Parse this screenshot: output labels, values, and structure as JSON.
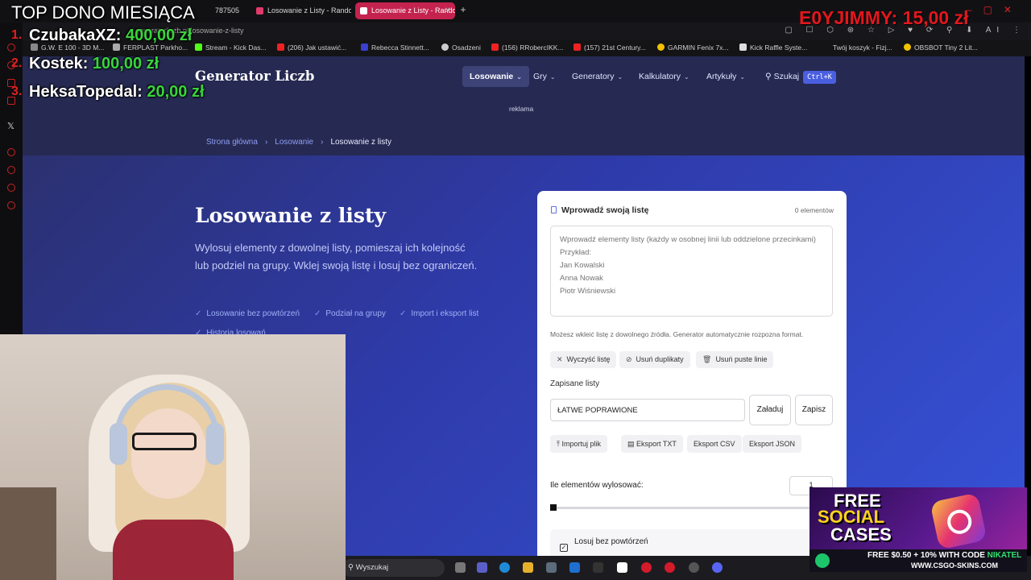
{
  "browser": {
    "tabs": [
      {
        "label": "787505"
      },
      {
        "label": "Losowanie z Listy - Rando"
      },
      {
        "label": "Losowanie z Listy - Rando",
        "active": true
      }
    ],
    "url": "generatorliczb.pl/losowanie-z-listy",
    "bookmarks": [
      "G.W. E 100 - 3D M...",
      "FERPLAST Parkho...",
      "Stream - Kick Das...",
      "(206) Jak ustawić...",
      "Rebecca Stinnett...",
      "Osadzeni",
      "(156) RRobercIKK...",
      "(157) 21st Century...",
      "GARMIN Fenix 7x...",
      "Kick Raffle Syste...",
      "Twój koszyk - Fizj...",
      "OBSBOT Tiny 2 Lit..."
    ],
    "toolbar_ai_label": "AI"
  },
  "site": {
    "logo": "Generator Liczb",
    "nav": [
      {
        "label": "Losowanie"
      },
      {
        "label": "Gry"
      },
      {
        "label": "Generatory"
      },
      {
        "label": "Kalkulatory"
      },
      {
        "label": "Artykuły"
      }
    ],
    "search_label": "Szukaj",
    "search_shortcut": "Ctrl+K",
    "ad_label": "reklama"
  },
  "breadcrumb": [
    "Strona główna",
    "Losowanie",
    "Losowanie z listy"
  ],
  "hero": {
    "title": "Losowanie z listy",
    "description": "Wylosuj elementy z dowolnej listy, pomieszaj ich kolejność lub podziel na grupy. Wklej swoją listę i losuj bez ograniczeń.",
    "features": [
      "Losowanie bez powtórzeń",
      "Podział na grupy",
      "Import i eksport list",
      "Historia losowań"
    ]
  },
  "card": {
    "title": "Wprowadź swoją listę",
    "count": "0 elementów",
    "textarea_placeholder": "Wprowadź elementy listy (każdy w osobnej linii lub oddzielone przecinkami)\nPrzykład:\nJan Kowalski\nAnna Nowak\nPiotr Wiśniewski",
    "hint": "Możesz wkleić listę z dowolnego źródła. Generator automatycznie rozpozna format.",
    "actions": [
      "Wyczyść listę",
      "Usuń duplikaty",
      "Usuń puste linie"
    ],
    "saved_label": "Zapisane listy",
    "saved_value": "ŁATWE POPRAWIONE",
    "load_label": "Załaduj",
    "save_label": "Zapisz",
    "import_label": "Importuj plik",
    "exports": [
      "Eksport TXT",
      "Eksport CSV",
      "Eksport JSON"
    ],
    "qty_label": "Ile elementów wylosować:",
    "qty_value": "1",
    "no_repeat_label": "Losuj bez powtórzeń",
    "no_repeat_checked": true
  },
  "taskbar": {
    "search_placeholder": "Wyszukaj"
  },
  "overlay": {
    "top_dono_title": "TOP DONO MIESIĄCA",
    "donors": [
      {
        "rank": "1.",
        "name": "CzubakaXZ:",
        "amount": "400,00 zł"
      },
      {
        "rank": "2.",
        "name": "Kostek:",
        "amount": "100,00 zł"
      },
      {
        "rank": "3.",
        "name": "HeksaTopedal:",
        "amount": "20,00 zł"
      }
    ],
    "last_donor": "E0YJIMMY: 15,00 zł"
  },
  "ad_banner": {
    "line1": "FREE",
    "line2": "SOCIAL",
    "line3": "CASES",
    "code_prefix": "FREE $0.50 + 10% WITH CODE",
    "code": "NIKATEL",
    "url": "WWW.CSGO-SKINS.COM"
  },
  "colors": {
    "accent": "#4a5fe0",
    "tab_active": "#c4234f",
    "donor_amount": "#39d43c",
    "donor_red": "#e3171d"
  }
}
